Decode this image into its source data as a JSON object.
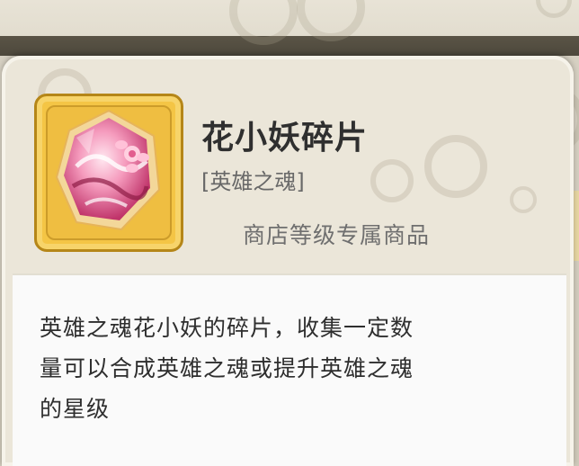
{
  "item": {
    "name": "花小妖碎片",
    "category": "[英雄之魂]",
    "shop_note": "商店等级专属商品",
    "description_lines": [
      "英雄之魂花小妖的碎片，收集一定数",
      "量可以合成英雄之魂或提升英雄之魂",
      "的星级"
    ],
    "icon": "pink-flower-crystal-shard-icon"
  },
  "colors": {
    "frame_gold": "#f4c545",
    "panel_bg": "#ebe6d9",
    "description_bg": "#fafafa"
  }
}
